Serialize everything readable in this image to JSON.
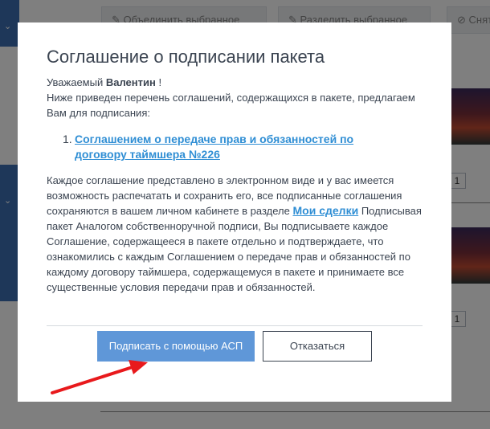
{
  "background": {
    "toolbar": {
      "merge_label": "Объединить выбранное",
      "split_label": "Разделить выбранное",
      "cancel_label": "Снять"
    },
    "quantities": [
      "1",
      "1"
    ]
  },
  "modal": {
    "title": "Соглашение о подписании пакета",
    "greeting_prefix": "Уважаемый",
    "user_name": "Валентин",
    "greeting_suffix": "!",
    "intro": "Ниже приведен перечень соглашений, содержащихся в пакете, предлагаем Вам для подписания:",
    "documents": [
      {
        "number": "1.",
        "label": "Соглашением о передаче прав и обязанностей по договору таймшера №226"
      }
    ],
    "body_part1": "Каждое соглашение представлено в электронном виде и у вас имеется возможность распечатать и сохранить его, все подписанные соглашения сохраняются в вашем личном кабинете в разделе",
    "deals_link": "Мои сделки",
    "body_part2": "Подписывая пакет Аналогом собственноручной подписи, Вы подписываете каждое Соглашение, содержащееся в пакете отдельно и подтверждаете, что ознакомились с каждым Соглашением о передаче прав и обязанностей по каждому договору таймшера, содержащемуся в пакете и принимаете все существенные условия передачи прав и обязанностей.",
    "sign_button": "Подписать с помощью АСП",
    "refuse_button": "Отказаться"
  },
  "colors": {
    "primary": "#5f97d8",
    "link": "#2f8ed4",
    "text": "#3b4451",
    "arrow": "#e8191c"
  }
}
